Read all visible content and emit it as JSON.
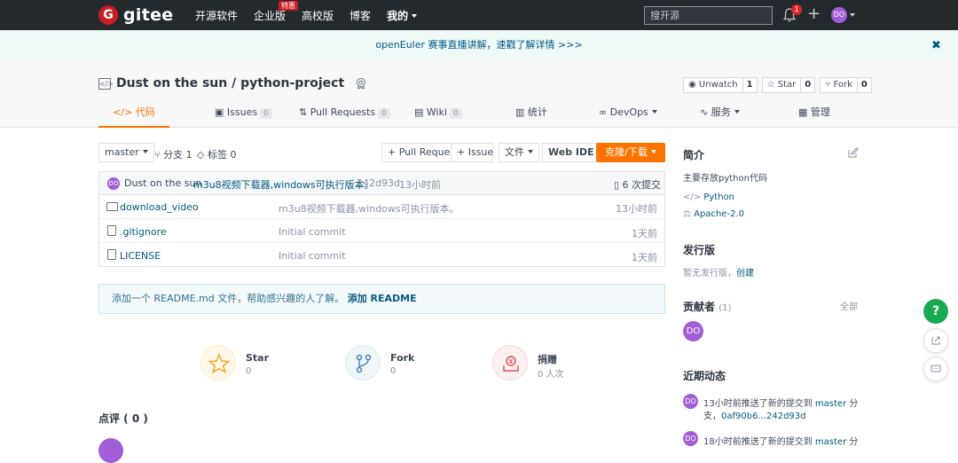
{
  "nav": {
    "logo_text": "gitee",
    "logo_badge": "G",
    "links": [
      "开源软件",
      "企业版",
      "高校版",
      "博客",
      "我的"
    ],
    "hot_badge": "特惠",
    "search_placeholder": "搜开源",
    "notification_count": "1",
    "avatar": "DO"
  },
  "banner": {
    "text": "openEuler 赛事直播讲解，速戳了解详情 >>>",
    "close": "✖"
  },
  "repo": {
    "title": "Dust on the sun / python-project",
    "watch": {
      "label": "Unwatch",
      "count": "1"
    },
    "star": {
      "label": "Star",
      "count": "0"
    },
    "fork": {
      "label": "Fork",
      "count": "0"
    },
    "tabs": [
      {
        "label": "代码",
        "count": ""
      },
      {
        "label": "Issues",
        "count": "0"
      },
      {
        "label": "Pull Requests",
        "count": "0"
      },
      {
        "label": "Wiki",
        "count": "0"
      },
      {
        "label": "统计",
        "count": ""
      },
      {
        "label": "DevOps",
        "count": ""
      },
      {
        "label": "服务",
        "count": ""
      },
      {
        "label": "管理",
        "count": ""
      }
    ]
  },
  "toolbar": {
    "branch": "master",
    "branches": "分支 1",
    "tags": "标签 0",
    "pull_request": "+ Pull Request",
    "issue": "+ Issue",
    "file": "文件",
    "webide": "Web IDE",
    "clone": "克隆/下载"
  },
  "commit": {
    "author_avatar": "DO",
    "author": "Dust on the sun",
    "message": "m3u8视频下载器,windows可执行版本。",
    "hash": "242d93d",
    "time": "13小时前",
    "count": "6 次提交"
  },
  "files": [
    {
      "name": "download_video",
      "type": "folder",
      "message": "m3u8视频下载器,windows可执行版本。",
      "time": "13小时前"
    },
    {
      "name": ".gitignore",
      "type": "file",
      "message": "Initial commit",
      "time": "1天前"
    },
    {
      "name": "LICENSE",
      "type": "file",
      "message": "Initial commit",
      "time": "1天前"
    }
  ],
  "readme_notice": {
    "text": "添加一个 README.md 文件，帮助感兴趣的人了解。",
    "link": "添加 README"
  },
  "stats": [
    {
      "label": "Star",
      "value": "0",
      "icon": "star-icon"
    },
    {
      "label": "Fork",
      "value": "0",
      "icon": "fork-icon"
    },
    {
      "label": "捐赠",
      "value": "0 人次",
      "icon": "donate-icon"
    }
  ],
  "review": "点评 ( 0 )",
  "sidebar": {
    "intro_title": "简介",
    "intro_text": "主要存放python代码",
    "language": "Python",
    "license": "Apache-2.0",
    "release_title": "发行版",
    "release_text": "暂无发行版，",
    "release_link": "创建",
    "contrib_title": "贡献者",
    "contrib_count": "(1)",
    "contrib_all": "全部",
    "contrib_avatar": "DO",
    "activity_title": "近期动态",
    "activities": [
      {
        "avatar": "DO",
        "line1a": "13小时前推送了新的提交到",
        "branch": "master",
        "line1b": "分",
        "line2a": "支，",
        "range": "0af90b6...242d93d"
      },
      {
        "avatar": "DO",
        "line1a": "18小时前推送了新的提交到",
        "branch": "master",
        "line1b": "分"
      }
    ]
  },
  "float": {
    "help": "?"
  },
  "colors": {
    "accent": "#fe7300",
    "nav_bg": "#24292e",
    "brand_red": "#c71d23",
    "avatar": "#a15ed6",
    "help_green": "#19a955"
  }
}
